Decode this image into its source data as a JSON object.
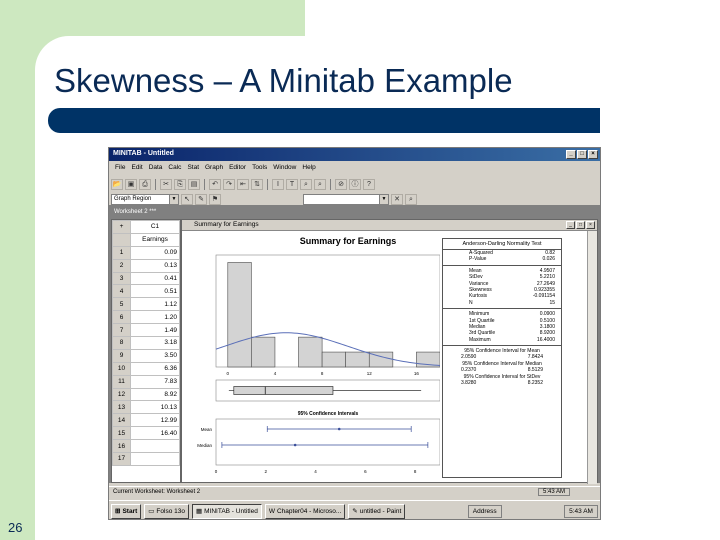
{
  "slide": {
    "title": "Skewness – A Minitab Example",
    "number": "26"
  },
  "colors": {
    "navy": "#003366",
    "green": "#cde8c0",
    "titlebar": "#0a246a"
  },
  "app": {
    "window_title": "MINITAB - Untitled",
    "menu": [
      "File",
      "Edit",
      "Data",
      "Calc",
      "Stat",
      "Graph",
      "Editor",
      "Tools",
      "Window",
      "Help"
    ],
    "graph_combo": "Graph Region",
    "toolbar1_icons": [
      "open-icon",
      "save-icon",
      "print-icon",
      "cut-icon",
      "copy-icon",
      "paste-icon",
      "undo-icon",
      "redo-icon",
      "previous-icon",
      "arrows-icon",
      "italic-icon",
      "text-icon",
      "find-icon",
      "find-next-icon",
      "cancel-icon",
      "info-icon",
      "help-icon"
    ],
    "toolbar2_icons": [
      "pointer-icon",
      "brush-icon",
      "flag-icon",
      "close-icon",
      "zoom-icon"
    ]
  },
  "worksheet": {
    "title": "Worksheet 2 ***",
    "column_id": "C1",
    "column_name": "Earnings",
    "rows": [
      "1",
      "2",
      "3",
      "4",
      "5",
      "6",
      "7",
      "8",
      "9",
      "10",
      "11",
      "12",
      "13",
      "14",
      "15",
      "16",
      "17"
    ],
    "values": [
      "0.09",
      "0.13",
      "0.41",
      "0.51",
      "1.12",
      "1.20",
      "1.49",
      "3.18",
      "3.50",
      "6.36",
      "7.83",
      "8.92",
      "10.13",
      "12.99",
      "16.40",
      "",
      ""
    ]
  },
  "summary": {
    "window_title": "Summary for Earnings",
    "heading": "Summary for Earnings",
    "ad_title": "Anderson-Darling Normality Test",
    "ad": [
      {
        "label": "A-Squared",
        "value": "0.82"
      },
      {
        "label": "P-Value",
        "value": "0.026"
      }
    ],
    "moments": [
      {
        "label": "Mean",
        "value": "4.9507"
      },
      {
        "label": "StDev",
        "value": "5.2210"
      },
      {
        "label": "Variance",
        "value": "27.2649"
      },
      {
        "label": "Skewness",
        "value": "0.923355"
      },
      {
        "label": "Kurtosis",
        "value": "-0.091154"
      },
      {
        "label": "N",
        "value": "15"
      }
    ],
    "quartiles": [
      {
        "label": "Minimum",
        "value": "0.0900"
      },
      {
        "label": "1st Quartile",
        "value": "0.5100"
      },
      {
        "label": "Median",
        "value": "3.1800"
      },
      {
        "label": "3rd Quartile",
        "value": "8.9200"
      },
      {
        "label": "Maximum",
        "value": "16.4000"
      }
    ],
    "ci_mean_title": "95% Confidence Interval for Mean",
    "ci_mean": [
      "2.0590",
      "7.8424"
    ],
    "ci_median_title": "95% Confidence Interval for Median",
    "ci_median": [
      "0.2370",
      "8.5129"
    ],
    "ci_stdev_title": "95% Confidence Interval for StDev",
    "ci_stdev": [
      "3.8280",
      "8.2352"
    ],
    "ci_plot_title": "95% Confidence Intervals",
    "ci_plot_labels": [
      "Mean",
      "Median"
    ]
  },
  "chart_data": {
    "type": "bar",
    "x_ticks": [
      "0",
      "4",
      "8",
      "12",
      "16"
    ],
    "bins": [
      {
        "from": 0,
        "to": 2,
        "count": 7
      },
      {
        "from": 2,
        "to": 4,
        "count": 2
      },
      {
        "from": 4,
        "to": 6,
        "count": 0
      },
      {
        "from": 6,
        "to": 8,
        "count": 2
      },
      {
        "from": 8,
        "to": 10,
        "count": 1
      },
      {
        "from": 10,
        "to": 12,
        "count": 1
      },
      {
        "from": 12,
        "to": 14,
        "count": 1
      },
      {
        "from": 14,
        "to": 16,
        "count": 0
      },
      {
        "from": 16,
        "to": 18,
        "count": 1
      }
    ],
    "xlim": [
      -1,
      18
    ],
    "ylim": [
      0,
      7.5
    ],
    "normal_fit": {
      "mean": 4.9507,
      "stdev": 5.221
    },
    "boxplot": {
      "min": 0.09,
      "q1": 0.51,
      "median": 3.18,
      "q3": 8.92,
      "max": 16.4
    },
    "ci_plot": {
      "x_ticks": [
        "0",
        "2",
        "4",
        "6",
        "8"
      ],
      "xlim": [
        0,
        9
      ],
      "mean": {
        "low": 2.059,
        "mid": 4.9507,
        "high": 7.8424
      },
      "median": {
        "low": 0.237,
        "mid": 3.18,
        "high": 8.5129
      }
    }
  },
  "status": {
    "text": "Current Worksheet: Worksheet 2",
    "clock": "5:43 AM"
  },
  "taskbar": {
    "start": "Start",
    "items": [
      "Folso 13o",
      "MINITAB - Untitled",
      "Chapter04 - Microso...",
      "untitled - Paint"
    ],
    "address": "Address",
    "clock": "5:43 AM"
  }
}
